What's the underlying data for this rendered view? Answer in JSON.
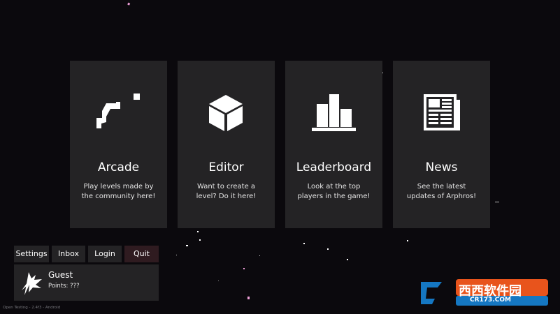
{
  "cards": [
    {
      "title": "Arcade",
      "desc1": "Play levels made by",
      "desc2": "the community here!",
      "icon": "arcade-icon"
    },
    {
      "title": "Editor",
      "desc1": "Want to create a",
      "desc2": "level? Do it here!",
      "icon": "cube-icon"
    },
    {
      "title": "Leaderboard",
      "desc1": "Look at the top",
      "desc2": "players in the game!",
      "icon": "bar-chart-icon"
    },
    {
      "title": "News",
      "desc1": "See the latest",
      "desc2": "updates of Arphros!",
      "icon": "newspaper-icon"
    }
  ],
  "menu": {
    "settings": "Settings",
    "inbox": "Inbox",
    "login": "Login",
    "quit": "Quit"
  },
  "profile": {
    "name": "Guest",
    "points": "Points: ???"
  },
  "footer": "Open Testing - 2.4f3 - Android",
  "watermark": {
    "text": "西西软件园",
    "url": "CR173.COM"
  },
  "colors": {
    "background": "#0b090d",
    "card": "#242325",
    "quit_button": "#2f1b20",
    "star_pink": "#f0a0d8"
  }
}
